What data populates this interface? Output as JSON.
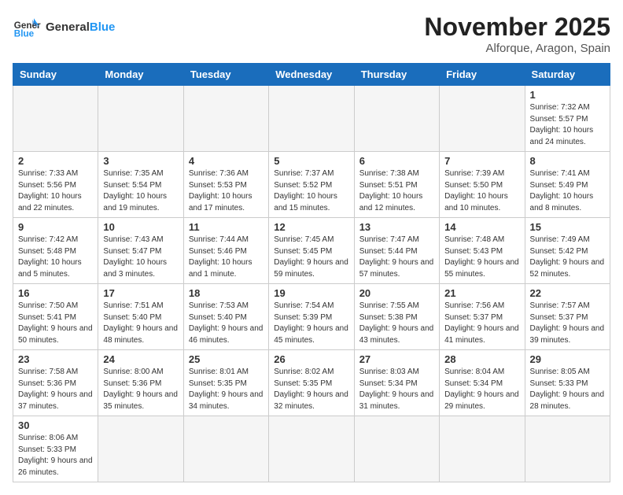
{
  "header": {
    "logo_general": "General",
    "logo_blue": "Blue",
    "month_title": "November 2025",
    "location": "Alforque, Aragon, Spain"
  },
  "days_of_week": [
    "Sunday",
    "Monday",
    "Tuesday",
    "Wednesday",
    "Thursday",
    "Friday",
    "Saturday"
  ],
  "weeks": [
    [
      {
        "day": "",
        "info": ""
      },
      {
        "day": "",
        "info": ""
      },
      {
        "day": "",
        "info": ""
      },
      {
        "day": "",
        "info": ""
      },
      {
        "day": "",
        "info": ""
      },
      {
        "day": "",
        "info": ""
      },
      {
        "day": "1",
        "info": "Sunrise: 7:32 AM\nSunset: 5:57 PM\nDaylight: 10 hours and 24 minutes."
      }
    ],
    [
      {
        "day": "2",
        "info": "Sunrise: 7:33 AM\nSunset: 5:56 PM\nDaylight: 10 hours and 22 minutes."
      },
      {
        "day": "3",
        "info": "Sunrise: 7:35 AM\nSunset: 5:54 PM\nDaylight: 10 hours and 19 minutes."
      },
      {
        "day": "4",
        "info": "Sunrise: 7:36 AM\nSunset: 5:53 PM\nDaylight: 10 hours and 17 minutes."
      },
      {
        "day": "5",
        "info": "Sunrise: 7:37 AM\nSunset: 5:52 PM\nDaylight: 10 hours and 15 minutes."
      },
      {
        "day": "6",
        "info": "Sunrise: 7:38 AM\nSunset: 5:51 PM\nDaylight: 10 hours and 12 minutes."
      },
      {
        "day": "7",
        "info": "Sunrise: 7:39 AM\nSunset: 5:50 PM\nDaylight: 10 hours and 10 minutes."
      },
      {
        "day": "8",
        "info": "Sunrise: 7:41 AM\nSunset: 5:49 PM\nDaylight: 10 hours and 8 minutes."
      }
    ],
    [
      {
        "day": "9",
        "info": "Sunrise: 7:42 AM\nSunset: 5:48 PM\nDaylight: 10 hours and 5 minutes."
      },
      {
        "day": "10",
        "info": "Sunrise: 7:43 AM\nSunset: 5:47 PM\nDaylight: 10 hours and 3 minutes."
      },
      {
        "day": "11",
        "info": "Sunrise: 7:44 AM\nSunset: 5:46 PM\nDaylight: 10 hours and 1 minute."
      },
      {
        "day": "12",
        "info": "Sunrise: 7:45 AM\nSunset: 5:45 PM\nDaylight: 9 hours and 59 minutes."
      },
      {
        "day": "13",
        "info": "Sunrise: 7:47 AM\nSunset: 5:44 PM\nDaylight: 9 hours and 57 minutes."
      },
      {
        "day": "14",
        "info": "Sunrise: 7:48 AM\nSunset: 5:43 PM\nDaylight: 9 hours and 55 minutes."
      },
      {
        "day": "15",
        "info": "Sunrise: 7:49 AM\nSunset: 5:42 PM\nDaylight: 9 hours and 52 minutes."
      }
    ],
    [
      {
        "day": "16",
        "info": "Sunrise: 7:50 AM\nSunset: 5:41 PM\nDaylight: 9 hours and 50 minutes."
      },
      {
        "day": "17",
        "info": "Sunrise: 7:51 AM\nSunset: 5:40 PM\nDaylight: 9 hours and 48 minutes."
      },
      {
        "day": "18",
        "info": "Sunrise: 7:53 AM\nSunset: 5:40 PM\nDaylight: 9 hours and 46 minutes."
      },
      {
        "day": "19",
        "info": "Sunrise: 7:54 AM\nSunset: 5:39 PM\nDaylight: 9 hours and 45 minutes."
      },
      {
        "day": "20",
        "info": "Sunrise: 7:55 AM\nSunset: 5:38 PM\nDaylight: 9 hours and 43 minutes."
      },
      {
        "day": "21",
        "info": "Sunrise: 7:56 AM\nSunset: 5:37 PM\nDaylight: 9 hours and 41 minutes."
      },
      {
        "day": "22",
        "info": "Sunrise: 7:57 AM\nSunset: 5:37 PM\nDaylight: 9 hours and 39 minutes."
      }
    ],
    [
      {
        "day": "23",
        "info": "Sunrise: 7:58 AM\nSunset: 5:36 PM\nDaylight: 9 hours and 37 minutes."
      },
      {
        "day": "24",
        "info": "Sunrise: 8:00 AM\nSunset: 5:36 PM\nDaylight: 9 hours and 35 minutes."
      },
      {
        "day": "25",
        "info": "Sunrise: 8:01 AM\nSunset: 5:35 PM\nDaylight: 9 hours and 34 minutes."
      },
      {
        "day": "26",
        "info": "Sunrise: 8:02 AM\nSunset: 5:35 PM\nDaylight: 9 hours and 32 minutes."
      },
      {
        "day": "27",
        "info": "Sunrise: 8:03 AM\nSunset: 5:34 PM\nDaylight: 9 hours and 31 minutes."
      },
      {
        "day": "28",
        "info": "Sunrise: 8:04 AM\nSunset: 5:34 PM\nDaylight: 9 hours and 29 minutes."
      },
      {
        "day": "29",
        "info": "Sunrise: 8:05 AM\nSunset: 5:33 PM\nDaylight: 9 hours and 28 minutes."
      }
    ],
    [
      {
        "day": "30",
        "info": "Sunrise: 8:06 AM\nSunset: 5:33 PM\nDaylight: 9 hours and 26 minutes."
      },
      {
        "day": "",
        "info": ""
      },
      {
        "day": "",
        "info": ""
      },
      {
        "day": "",
        "info": ""
      },
      {
        "day": "",
        "info": ""
      },
      {
        "day": "",
        "info": ""
      },
      {
        "day": "",
        "info": ""
      }
    ]
  ]
}
